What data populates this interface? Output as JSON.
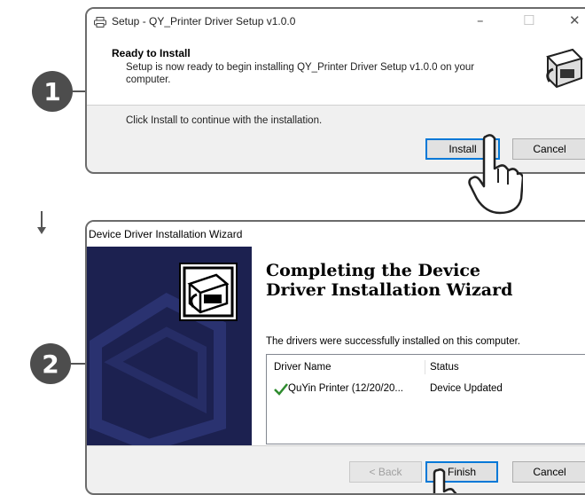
{
  "steps": [
    "1",
    "2"
  ],
  "setup_dialog": {
    "title": "Setup - QY_Printer Driver Setup v1.0.0",
    "header_title": "Ready to Install",
    "header_subtitle": "Setup is now ready to begin installing QY_Printer Driver Setup v1.0.0 on your computer.",
    "instruction": "Click Install to continue with the installation.",
    "install_label": "Install",
    "cancel_label": "Cancel"
  },
  "wizard_dialog": {
    "title": "Device Driver Installation Wizard",
    "heading": "Completing the Device Driver Installation Wizard",
    "message": "The drivers were successfully installed on this computer.",
    "columns": [
      "Driver Name",
      "Status"
    ],
    "rows": [
      {
        "driver": "QuYin Printer  (12/20/20...",
        "status": "Device Updated"
      }
    ],
    "back_label": "< Back",
    "finish_label": "Finish",
    "cancel_label": "Cancel"
  },
  "icons": [
    "printer-icon",
    "setup-logo-icon",
    "hand-cursor-icon",
    "down-arrow-icon",
    "installer-box-icon",
    "checkmark-icon"
  ],
  "colors": {
    "badge": "#4d4d4d",
    "wizard_sidebar": "#1c2150",
    "accent_border": "#0078d7",
    "check_green": "#2e8b2e"
  }
}
